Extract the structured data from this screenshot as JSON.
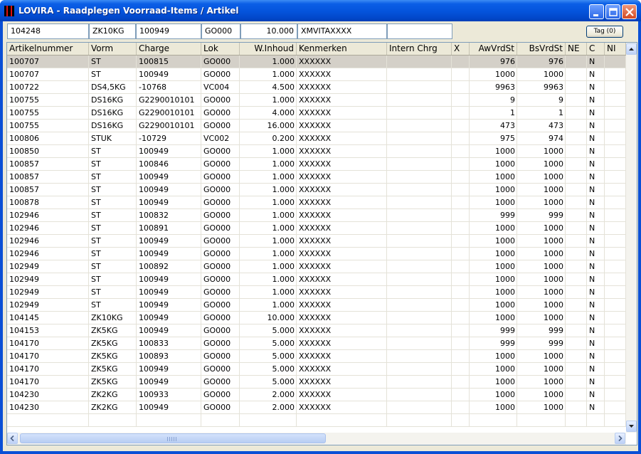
{
  "window": {
    "title": "LOVIRA - Raadplegen Voorraad-Items / Artikel"
  },
  "filter": {
    "fields": [
      "104248",
      "ZK10KG",
      "100949",
      "GO000",
      "10.000",
      "XMVITAXXXX",
      ""
    ],
    "tag_button": "Tag (0)"
  },
  "table": {
    "columns": [
      "Artikelnummer",
      "Vorm",
      "Charge",
      "Lok",
      "W.Inhoud",
      "Kenmerken",
      "Intern Chrg",
      "X",
      "AwVrdSt",
      "BsVrdSt",
      "NE",
      "C",
      "NI"
    ],
    "rows": [
      [
        "100707",
        "ST",
        "100815",
        "GO000",
        "1.000",
        "XXXXXX",
        "",
        "",
        "976",
        "976",
        "",
        "N",
        ""
      ],
      [
        "100707",
        "ST",
        "100949",
        "GO000",
        "1.000",
        "XXXXXX",
        "",
        "",
        "1000",
        "1000",
        "",
        "N",
        ""
      ],
      [
        "100722",
        "DS4,5KG",
        "-10768",
        "VC004",
        "4.500",
        "XXXXXX",
        "",
        "",
        "9963",
        "9963",
        "",
        "N",
        ""
      ],
      [
        "100755",
        "DS16KG",
        "G2290010101",
        "GO000",
        "1.000",
        "XXXXXX",
        "",
        "",
        "9",
        "9",
        "",
        "N",
        ""
      ],
      [
        "100755",
        "DS16KG",
        "G2290010101",
        "GO000",
        "4.000",
        "XXXXXX",
        "",
        "",
        "1",
        "1",
        "",
        "N",
        ""
      ],
      [
        "100755",
        "DS16KG",
        "G2290010101",
        "GO000",
        "16.000",
        "XXXXXX",
        "",
        "",
        "473",
        "473",
        "",
        "N",
        ""
      ],
      [
        "100806",
        "STUK",
        "-10729",
        "VC002",
        "0.200",
        "XXXXXX",
        "",
        "",
        "975",
        "974",
        "",
        "N",
        ""
      ],
      [
        "100850",
        "ST",
        "100949",
        "GO000",
        "1.000",
        "XXXXXX",
        "",
        "",
        "1000",
        "1000",
        "",
        "N",
        ""
      ],
      [
        "100857",
        "ST",
        "100846",
        "GO000",
        "1.000",
        "XXXXXX",
        "",
        "",
        "1000",
        "1000",
        "",
        "N",
        ""
      ],
      [
        "100857",
        "ST",
        "100949",
        "GO000",
        "1.000",
        "XXXXXX",
        "",
        "",
        "1000",
        "1000",
        "",
        "N",
        ""
      ],
      [
        "100857",
        "ST",
        "100949",
        "GO000",
        "1.000",
        "XXXXXX",
        "",
        "",
        "1000",
        "1000",
        "",
        "N",
        ""
      ],
      [
        "100878",
        "ST",
        "100949",
        "GO000",
        "1.000",
        "XXXXXX",
        "",
        "",
        "1000",
        "1000",
        "",
        "N",
        ""
      ],
      [
        "102946",
        "ST",
        "100832",
        "GO000",
        "1.000",
        "XXXXXX",
        "",
        "",
        "999",
        "999",
        "",
        "N",
        ""
      ],
      [
        "102946",
        "ST",
        "100891",
        "GO000",
        "1.000",
        "XXXXXX",
        "",
        "",
        "1000",
        "1000",
        "",
        "N",
        ""
      ],
      [
        "102946",
        "ST",
        "100949",
        "GO000",
        "1.000",
        "XXXXXX",
        "",
        "",
        "1000",
        "1000",
        "",
        "N",
        ""
      ],
      [
        "102946",
        "ST",
        "100949",
        "GO000",
        "1.000",
        "XXXXXX",
        "",
        "",
        "1000",
        "1000",
        "",
        "N",
        ""
      ],
      [
        "102949",
        "ST",
        "100892",
        "GO000",
        "1.000",
        "XXXXXX",
        "",
        "",
        "1000",
        "1000",
        "",
        "N",
        ""
      ],
      [
        "102949",
        "ST",
        "100949",
        "GO000",
        "1.000",
        "XXXXXX",
        "",
        "",
        "1000",
        "1000",
        "",
        "N",
        ""
      ],
      [
        "102949",
        "ST",
        "100949",
        "GO000",
        "1.000",
        "XXXXXX",
        "",
        "",
        "1000",
        "1000",
        "",
        "N",
        ""
      ],
      [
        "102949",
        "ST",
        "100949",
        "GO000",
        "1.000",
        "XXXXXX",
        "",
        "",
        "1000",
        "1000",
        "",
        "N",
        ""
      ],
      [
        "104145",
        "ZK10KG",
        "100949",
        "GO000",
        "10.000",
        "XXXXXX",
        "",
        "",
        "1000",
        "1000",
        "",
        "N",
        ""
      ],
      [
        "104153",
        "ZK5KG",
        "100949",
        "GO000",
        "5.000",
        "XXXXXX",
        "",
        "",
        "999",
        "999",
        "",
        "N",
        ""
      ],
      [
        "104170",
        "ZK5KG",
        "100833",
        "GO000",
        "5.000",
        "XXXXXX",
        "",
        "",
        "999",
        "999",
        "",
        "N",
        ""
      ],
      [
        "104170",
        "ZK5KG",
        "100893",
        "GO000",
        "5.000",
        "XXXXXX",
        "",
        "",
        "1000",
        "1000",
        "",
        "N",
        ""
      ],
      [
        "104170",
        "ZK5KG",
        "100949",
        "GO000",
        "5.000",
        "XXXXXX",
        "",
        "",
        "1000",
        "1000",
        "",
        "N",
        ""
      ],
      [
        "104170",
        "ZK5KG",
        "100949",
        "GO000",
        "5.000",
        "XXXXXX",
        "",
        "",
        "1000",
        "1000",
        "",
        "N",
        ""
      ],
      [
        "104230",
        "ZK2KG",
        "100933",
        "GO000",
        "2.000",
        "XXXXXX",
        "",
        "",
        "1000",
        "1000",
        "",
        "N",
        ""
      ],
      [
        "104230",
        "ZK2KG",
        "100949",
        "GO000",
        "2.000",
        "XXXXXX",
        "",
        "",
        "1000",
        "1000",
        "",
        "N",
        ""
      ],
      [
        "",
        "",
        "",
        "",
        "",
        "",
        "",
        "",
        "",
        "",
        "",
        "",
        ""
      ]
    ],
    "selected_row": 0
  },
  "icons": {
    "app": "lovira-app-icon",
    "minimize": "minimize-icon",
    "maximize": "maximize-icon",
    "close": "close-icon",
    "scroll_up": "arrow-up-icon",
    "scroll_down": "arrow-down-icon",
    "scroll_left": "arrow-left-icon",
    "scroll_right": "arrow-right-icon"
  },
  "colors": {
    "titlebar": "#0453db",
    "selected_row": "#d4d0c8",
    "client": "#ece9d8"
  }
}
